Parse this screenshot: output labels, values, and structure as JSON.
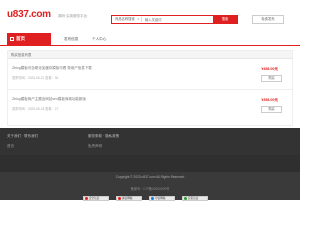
{
  "header": {
    "logo": "u837.com",
    "tagline": "源码·买卖服务平台",
    "search": {
      "type_label": "商品名称搜索",
      "placeholder": "输入关键词",
      "button_label": "搜索"
    },
    "post_button_label": "免费发布"
  },
  "nav": {
    "home_label": "首页",
    "tabs": [
      {
        "label": "发布信息"
      },
      {
        "label": "个人中心"
      }
    ]
  },
  "section": {
    "title": "购买信息列表"
  },
  "items": [
    {
      "title": "Zblog模板可自助化加缓存模板可看 带用户信息下载",
      "subtitle": "发布时间：2023-05-21 查看：32",
      "price": "¥458.00元",
      "button_label": "购买"
    },
    {
      "title": "Zblog模板商户主题含网站seo模板商城功能新版",
      "subtitle": "发布时间：2023-05-18 查看：27",
      "price": "¥358.00元",
      "button_label": "购买"
    }
  ],
  "footer": {
    "columns": [
      {
        "title": "关于我们 · 联系我们",
        "link": "首页"
      },
      {
        "title": "服务条款 · 隐私政策",
        "link": "免责声明"
      }
    ],
    "copyright": "Copyright © 2023 u837.com All Rights Reserved",
    "icp": "备案号：ICP备00000000号",
    "badges": [
      {
        "label": "安全认证",
        "color": "#e02020"
      },
      {
        "label": "诚信网站",
        "color": "#e02020"
      },
      {
        "label": "可信网站",
        "color": "#1a7ad9"
      },
      {
        "label": "实名认证",
        "color": "#2a9d2a"
      }
    ]
  },
  "colors": {
    "brand_red": "#e02020",
    "footer_bg": "#3a3a3a"
  }
}
